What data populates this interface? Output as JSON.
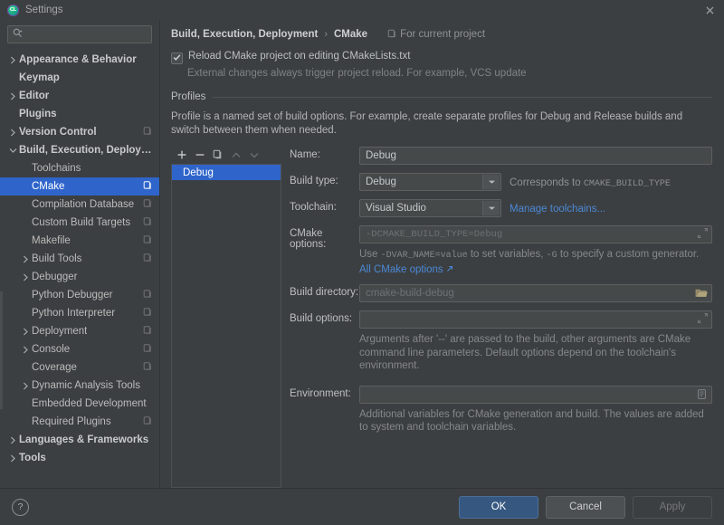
{
  "window": {
    "title": "Settings",
    "app_badge": "CL",
    "close_icon": "close-icon"
  },
  "sidebar": {
    "search": {
      "value": "",
      "placeholder": ""
    },
    "items": [
      {
        "label": "Appearance & Behavior",
        "indent": 0,
        "arrow": "collapsed",
        "bold": true,
        "pin": false,
        "selected": false
      },
      {
        "label": "Keymap",
        "indent": 0,
        "arrow": "none",
        "bold": true,
        "pin": false,
        "selected": false
      },
      {
        "label": "Editor",
        "indent": 0,
        "arrow": "collapsed",
        "bold": true,
        "pin": false,
        "selected": false
      },
      {
        "label": "Plugins",
        "indent": 0,
        "arrow": "none",
        "bold": true,
        "pin": false,
        "selected": false
      },
      {
        "label": "Version Control",
        "indent": 0,
        "arrow": "collapsed",
        "bold": true,
        "pin": true,
        "selected": false
      },
      {
        "label": "Build, Execution, Deployment",
        "indent": 0,
        "arrow": "expanded",
        "bold": true,
        "pin": false,
        "selected": false
      },
      {
        "label": "Toolchains",
        "indent": 1,
        "arrow": "none",
        "bold": false,
        "pin": false,
        "selected": false
      },
      {
        "label": "CMake",
        "indent": 1,
        "arrow": "none",
        "bold": false,
        "pin": true,
        "selected": true
      },
      {
        "label": "Compilation Database",
        "indent": 1,
        "arrow": "none",
        "bold": false,
        "pin": true,
        "selected": false
      },
      {
        "label": "Custom Build Targets",
        "indent": 1,
        "arrow": "none",
        "bold": false,
        "pin": true,
        "selected": false
      },
      {
        "label": "Makefile",
        "indent": 1,
        "arrow": "none",
        "bold": false,
        "pin": true,
        "selected": false
      },
      {
        "label": "Build Tools",
        "indent": 1,
        "arrow": "collapsed",
        "bold": false,
        "pin": true,
        "selected": false
      },
      {
        "label": "Debugger",
        "indent": 1,
        "arrow": "collapsed",
        "bold": false,
        "pin": false,
        "selected": false
      },
      {
        "label": "Python Debugger",
        "indent": 1,
        "arrow": "none",
        "bold": false,
        "pin": true,
        "selected": false
      },
      {
        "label": "Python Interpreter",
        "indent": 1,
        "arrow": "none",
        "bold": false,
        "pin": true,
        "selected": false
      },
      {
        "label": "Deployment",
        "indent": 1,
        "arrow": "collapsed",
        "bold": false,
        "pin": true,
        "selected": false
      },
      {
        "label": "Console",
        "indent": 1,
        "arrow": "collapsed",
        "bold": false,
        "pin": true,
        "selected": false
      },
      {
        "label": "Coverage",
        "indent": 1,
        "arrow": "none",
        "bold": false,
        "pin": true,
        "selected": false
      },
      {
        "label": "Dynamic Analysis Tools",
        "indent": 1,
        "arrow": "collapsed",
        "bold": false,
        "pin": false,
        "selected": false
      },
      {
        "label": "Embedded Development",
        "indent": 1,
        "arrow": "none",
        "bold": false,
        "pin": false,
        "selected": false
      },
      {
        "label": "Required Plugins",
        "indent": 1,
        "arrow": "none",
        "bold": false,
        "pin": true,
        "selected": false
      },
      {
        "label": "Languages & Frameworks",
        "indent": 0,
        "arrow": "collapsed",
        "bold": true,
        "pin": false,
        "selected": false
      },
      {
        "label": "Tools",
        "indent": 0,
        "arrow": "collapsed",
        "bold": true,
        "pin": false,
        "selected": false
      }
    ]
  },
  "main": {
    "breadcrumb": {
      "parent": "Build, Execution, Deployment",
      "separator": "›",
      "current": "CMake"
    },
    "scope_label": "For current project",
    "reload_checkbox": {
      "label": "Reload CMake project on editing CMakeLists.txt",
      "checked": true
    },
    "reload_note": "External changes always trigger project reload. For example, VCS update",
    "profiles_group_title": "Profiles",
    "profiles_description": "Profile is a named set of build options. For example, create separate profiles for Debug and Release builds and switch between them when needed.",
    "profile_toolbar": [
      {
        "name": "add-profile-button",
        "glyph": "+",
        "enabled": true
      },
      {
        "name": "remove-profile-button",
        "glyph": "−",
        "enabled": true
      },
      {
        "name": "copy-profile-button",
        "glyph": "copy",
        "enabled": true
      },
      {
        "name": "move-up-button",
        "glyph": "▲",
        "enabled": false
      },
      {
        "name": "move-down-button",
        "glyph": "▼",
        "enabled": false
      }
    ],
    "profile_list": [
      {
        "label": "Debug",
        "selected": true
      }
    ],
    "fields": {
      "name": {
        "label": "Name:",
        "value": "Debug",
        "placeholder": ""
      },
      "build_type": {
        "label": "Build type:",
        "value": "Debug",
        "aside_prefix": "Corresponds to ",
        "aside_mono": "CMAKE_BUILD_TYPE"
      },
      "toolchain": {
        "label": "Toolchain:",
        "value": "Visual Studio",
        "link": "Manage toolchains..."
      },
      "cmake_options": {
        "label": "CMake options:",
        "value": "",
        "placeholder": "-DCMAKE_BUILD_TYPE=Debug"
      },
      "build_directory": {
        "label": "Build directory:",
        "value": "",
        "placeholder": "cmake-build-debug"
      },
      "build_options": {
        "label": "Build options:",
        "value": "",
        "placeholder": ""
      },
      "environment": {
        "label": "Environment:",
        "value": "",
        "placeholder": ""
      }
    },
    "hints": {
      "cmake_options_1": "Use ",
      "cmake_options_mono_a": "-DVAR_NAME=value",
      "cmake_options_2": " to set variables, ",
      "cmake_options_mono_b": "-G",
      "cmake_options_3": " to specify a custom generator.",
      "cmake_options_link": "All CMake options",
      "build_options": "Arguments after '--' are passed to the build, other arguments are CMake command line parameters. Default options depend on the toolchain's environment.",
      "environment": "Additional variables for CMake generation and build. The values are added to system and toolchain variables."
    }
  },
  "footer": {
    "help_glyph": "?",
    "ok_label": "OK",
    "cancel_label": "Cancel",
    "apply_label": "Apply",
    "apply_enabled": false
  },
  "colors": {
    "accent": "#2f65ca",
    "primary_button": "#365880",
    "link": "#4b88d6",
    "background": "#3c3f41",
    "field": "#45494a"
  }
}
